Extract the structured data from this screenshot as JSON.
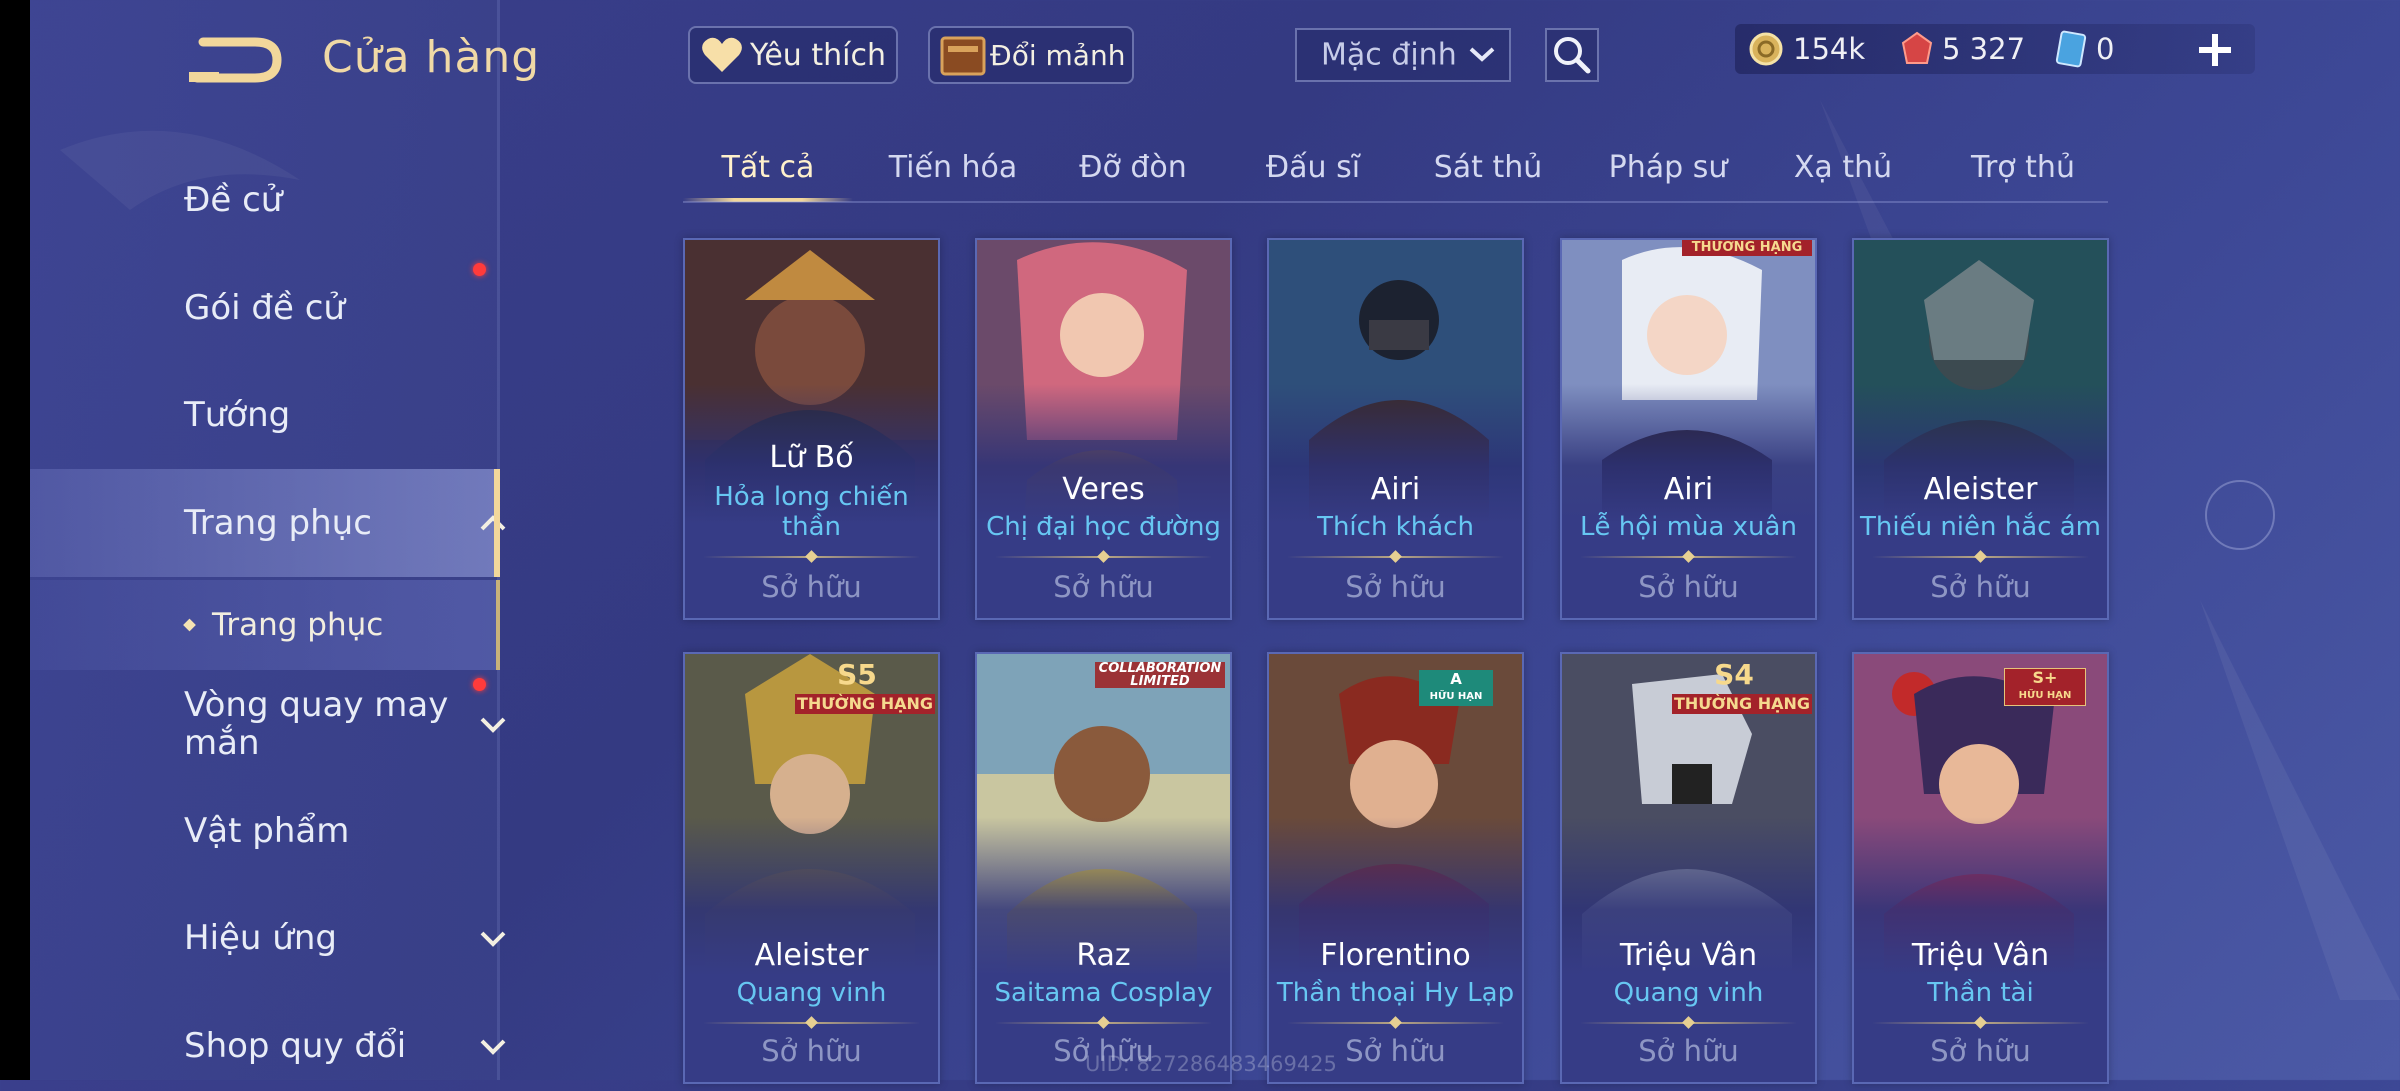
{
  "header": {
    "title": "Cửa hàng",
    "favorites_label": "Yêu thích",
    "exchange_label": "Đổi mảnh",
    "sort": {
      "selected": "Mặc định"
    }
  },
  "currency": {
    "gold": "154k",
    "vouchers": "5 327",
    "gems": "0"
  },
  "sidebar": {
    "items": [
      {
        "label": "Đề cử"
      },
      {
        "label": "Gói đề cử"
      },
      {
        "label": "Tướng"
      },
      {
        "label": "Trang phục"
      },
      {
        "label": "Vòng quay may mắn"
      },
      {
        "label": "Vật phẩm"
      },
      {
        "label": "Hiệu ứng"
      },
      {
        "label": "Shop quy đổi"
      }
    ],
    "sub_item": "Trang phục"
  },
  "tabs": [
    {
      "label": "Tất cả"
    },
    {
      "label": "Tiến hóa"
    },
    {
      "label": "Đỡ đòn"
    },
    {
      "label": "Đấu sĩ"
    },
    {
      "label": "Sát thủ"
    },
    {
      "label": "Pháp sư"
    },
    {
      "label": "Xạ thủ"
    },
    {
      "label": "Trợ thủ"
    }
  ],
  "skins": [
    {
      "hero": "Lữ Bố",
      "skin": "Hỏa long chiến thần",
      "status": "Sở hữu",
      "badge": ""
    },
    {
      "hero": "Veres",
      "skin": "Chị đại học đường",
      "status": "Sở hữu",
      "badge": ""
    },
    {
      "hero": "Airi",
      "skin": "Thích khách",
      "status": "Sở hữu",
      "badge": ""
    },
    {
      "hero": "Airi",
      "skin": "Lễ hội mùa xuân",
      "status": "Sở hữu",
      "badge": "THƯỜNG HẠNG"
    },
    {
      "hero": "Aleister",
      "skin": "Thiếu niên hắc ám",
      "status": "Sở hữu",
      "badge": ""
    },
    {
      "hero": "Aleister",
      "skin": "Quang vinh",
      "status": "Sở hữu",
      "badge_tier": "S5",
      "badge": "THƯỜNG HẠNG"
    },
    {
      "hero": "Raz",
      "skin": "Saitama Cosplay",
      "status": "Sở hữu",
      "badge": "COLLABORATION LIMITED"
    },
    {
      "hero": "Florentino",
      "skin": "Thần thoại Hy Lạp",
      "status": "Sở hữu",
      "badge_tier": "A",
      "badge": "HỮU HẠN"
    },
    {
      "hero": "Triệu Vân",
      "skin": "Quang vinh",
      "status": "Sở hữu",
      "badge_tier": "S4",
      "badge": "THƯỜNG HẠNG"
    },
    {
      "hero": "Triệu Vân",
      "skin": "Thần tài",
      "status": "Sở hữu",
      "badge_tier": "S+",
      "badge": "HỮU HẠN"
    }
  ],
  "uid_text": "UID: 827286483469425",
  "colors": {
    "accent_gold": "#f2d79b",
    "skin_name": "#67c7f2",
    "background": "#3a3f8c",
    "notification": "#ff3b3b"
  }
}
